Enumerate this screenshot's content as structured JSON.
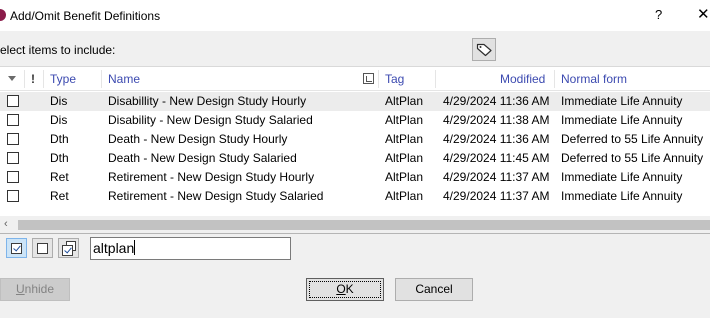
{
  "window": {
    "title": "Add/Omit Benefit Definitions",
    "help": "?",
    "close": "✕"
  },
  "prompt": "elect items to include:",
  "columns": {
    "bang": "!",
    "type": "Type",
    "name": "Name",
    "tag": "Tag",
    "modified": "Modified",
    "normal_form": "Normal form"
  },
  "rows": [
    {
      "type": "Dis",
      "name": "Disabillity - New Design Study Hourly",
      "tag": "AltPlan",
      "modified": "4/29/2024 11:36 AM",
      "normal_form": "Immediate Life Annuity",
      "checked": false
    },
    {
      "type": "Dis",
      "name": "Disability - New Design Study Salaried",
      "tag": "AltPlan",
      "modified": "4/29/2024 11:38 AM",
      "normal_form": "Immediate Life Annuity",
      "checked": false
    },
    {
      "type": "Dth",
      "name": "Death - New Design Study Hourly",
      "tag": "AltPlan",
      "modified": "4/29/2024 11:36 AM",
      "normal_form": "Deferred to 55 Life Annuity",
      "checked": false
    },
    {
      "type": "Dth",
      "name": "Death - New Design Study Salaried",
      "tag": "AltPlan",
      "modified": "4/29/2024 11:45 AM",
      "normal_form": "Deferred to 55 Life Annuity",
      "checked": false
    },
    {
      "type": "Ret",
      "name": "Retirement - New Design Study Hourly",
      "tag": "AltPlan",
      "modified": "4/29/2024 11:37 AM",
      "normal_form": "Immediate Life Annuity",
      "checked": false
    },
    {
      "type": "Ret",
      "name": "Retirement - New Design Study Salaried",
      "tag": "AltPlan",
      "modified": "4/29/2024 11:37 AM",
      "normal_form": "Immediate Life Annuity",
      "checked": false
    }
  ],
  "filter": {
    "value": "altplan"
  },
  "buttons": {
    "unhide_accel": "U",
    "unhide_rest": "nhide",
    "ok_accel": "O",
    "ok_rest": "K",
    "cancel": "Cancel"
  },
  "icons": {
    "tag_button": "tag-icon",
    "check_all": "check-all-icon",
    "uncheck_all": "uncheck-all-icon",
    "toggle_checked": "toggle-checked-icon"
  },
  "colors": {
    "header_text": "#3c4ab0",
    "selected_row": "#ececec",
    "app_icon": "#8a1b4a"
  }
}
